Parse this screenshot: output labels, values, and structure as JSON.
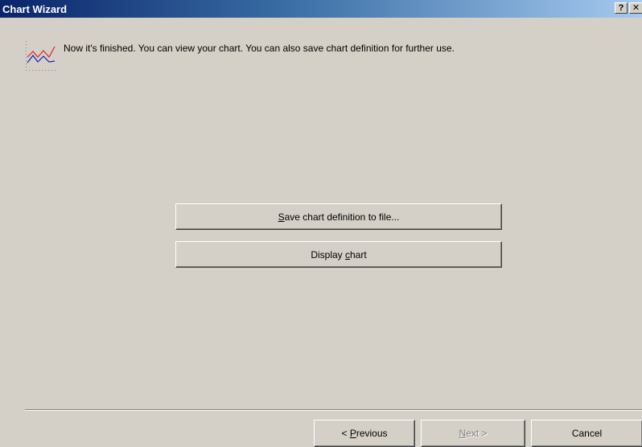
{
  "window": {
    "title": "Chart Wizard",
    "help_label": "?",
    "close_label": "✕"
  },
  "header": {
    "icon": "chart-wizard-icon",
    "message": "Now it's finished. You can view your chart. You can also save chart definition for further use."
  },
  "actions": {
    "save": {
      "mnemonic": "S",
      "rest": "ave chart definition to file..."
    },
    "display": {
      "before": "Display ",
      "mnemonic": "c",
      "after": "hart"
    }
  },
  "footer": {
    "previous": {
      "before": "< ",
      "mnemonic": "P",
      "after": "revious"
    },
    "next": {
      "mnemonic": "N",
      "after": "ext >",
      "enabled": false
    },
    "cancel": "Cancel"
  },
  "colors": {
    "titlebar_start": "#0a246a",
    "titlebar_end": "#a6caf0",
    "dialog_bg": "#d4d0c8",
    "disabled_text": "#808080"
  }
}
